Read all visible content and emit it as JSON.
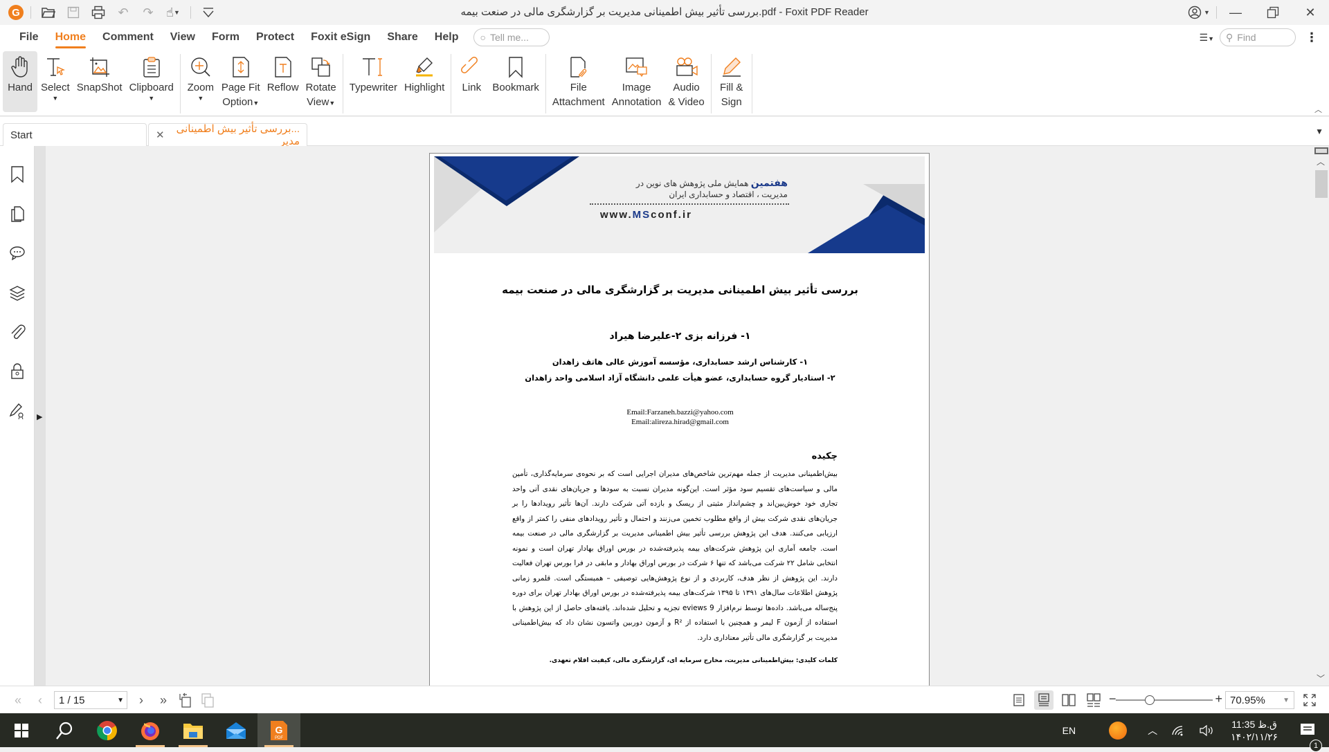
{
  "window": {
    "title": "بررسی تأثیر بیش اطمینانی مدیریت بر گزارشگری مالی در صنعت بیمه.pdf - Foxit PDF Reader"
  },
  "menu": {
    "items": [
      "File",
      "Home",
      "Comment",
      "View",
      "Form",
      "Protect",
      "Foxit eSign",
      "Share",
      "Help"
    ],
    "active": "Home",
    "tell_me_placeholder": "Tell me...",
    "find_placeholder": "Find"
  },
  "ribbon": {
    "hand": "Hand",
    "select": "Select",
    "snapshot": "SnapShot",
    "clipboard": "Clipboard",
    "zoom": "Zoom",
    "page_fit_1": "Page Fit",
    "page_fit_2": "Option",
    "reflow": "Reflow",
    "rotate_1": "Rotate",
    "rotate_2": "View",
    "typewriter": "Typewriter",
    "highlight": "Highlight",
    "link": "Link",
    "bookmark": "Bookmark",
    "file_att_1": "File",
    "file_att_2": "Attachment",
    "image_ann_1": "Image",
    "image_ann_2": "Annotation",
    "audio_1": "Audio",
    "audio_2": "& Video",
    "fill_1": "Fill &",
    "fill_2": "Sign"
  },
  "tabs": {
    "start": "Start",
    "document": "...بررسی تأثیر بیش اطمینانی مدیر"
  },
  "document": {
    "conference_highlight": "هفتمین",
    "conference_line1": " همایش ملی پژوهش های نوین در",
    "conference_line2": "مدیریت ، اقتصاد و حسابداری ایران",
    "url_prefix": "www.",
    "url_brand": "MS",
    "url_suffix": "conf.ir",
    "title": "بررسی تأثیر بیش اطمینانی مدیریت بر گزارشگری مالی در صنعت بیمه",
    "authors": "۱- فرزانه بزی ۲-علیرضا هیراد",
    "affiliation_1": "۱-  کارشناس ارشد حسابداری، مؤسسه آموزش عالی هاتف زاهدان",
    "affiliation_2": "۲-  استادیار گروه حسابداری، عضو هیأت علمی دانشگاه آزاد اسلامی واحد زاهدان",
    "email_1": "Email:Farzaneh.bazzi@yahoo.com",
    "email_2": "Email:alireza.hirad@gmail.com",
    "abstract_heading": "چکیده",
    "abstract": "بیش‌اطمینانی مدیریت از جمله مهم‌ترین شاخص‌های مدیران اجرایی است که بر نحوه‌ی سرمایه‌گذاری، تأمین مالی و سیاست‌های تقسیم سود مؤثر است. این‌گونه مدیران نسبت به سودها و جریان‌های نقدی آتی واحد تجاری خود خوش‌بین‌اند و چشم‌انداز مثبتی از ریسک و بازده آتی شرکت دارند. آن‌ها تأثیر رویدادها را بر جریان‌های نقدی شرکت بیش از واقع مطلوب تخمین می‌زنند و احتمال و تأثیر رویدادهای منفی را کمتر از واقع ارزیابی می‌کنند. هدف این پژوهش بررسی تأثیر بیش اطمینانی مدیریت بر گزارشگری مالی در صنعت بیمه است. جامعه آماری این پژوهش شرکت‌های بیمه پذیرفته‌شده در بورس اوراق بهادار تهران است و نمونه انتخابی شامل ۲۲ شرکت می‌باشد که تنها ۶ شرکت در بورس اوراق بهادار و مابقی در فرا بورس تهران فعالیت دارند. این پژوهش از نظر هدف، کاربردی و از نوع پژوهش‌هایی توصیفی – همبستگی است. قلمرو زمانی پژوهش اطلاعات سال‌های ۱۳۹۱ تا ۱۳۹۵ شرکت‌های بیمه پذیرفته‌شده در بورس اوراق بهادار تهران برای دوره پنج‌ساله می‌باشد. داده‌ها توسط نرم‌افزار eviews 9 تجزیه و تحلیل شده‌اند. یافته‌های حاصل از این پژوهش با استفاده از آزمون F لیمر و همچنین با استفاده از R² و آزمون دوربین واتسون نشان داد که بیش‌اطمینانی مدیریت بر گزارشگری مالی تأثیر معناداری دارد.",
    "keywords": "کلمات کلیدی: بیش‌اطمینانی مدیریت، مخارج سرمایه ای، گزارشگری مالی، کیفیت اقلام تعهدی."
  },
  "status": {
    "page_display": "1 / 15",
    "current_page": 1,
    "total_pages": 15,
    "zoom_value": "70.95%",
    "zoom_slider_fraction": 0.35
  },
  "taskbar": {
    "language": "EN",
    "time": "11:35 ق.ظ",
    "date": "۱۴۰۲/۱۱/۲۶",
    "notification_count": "1"
  },
  "colors": {
    "accent": "#f07f1e",
    "brand_blue": "#1b3a8a",
    "taskbar": "#272a23"
  }
}
